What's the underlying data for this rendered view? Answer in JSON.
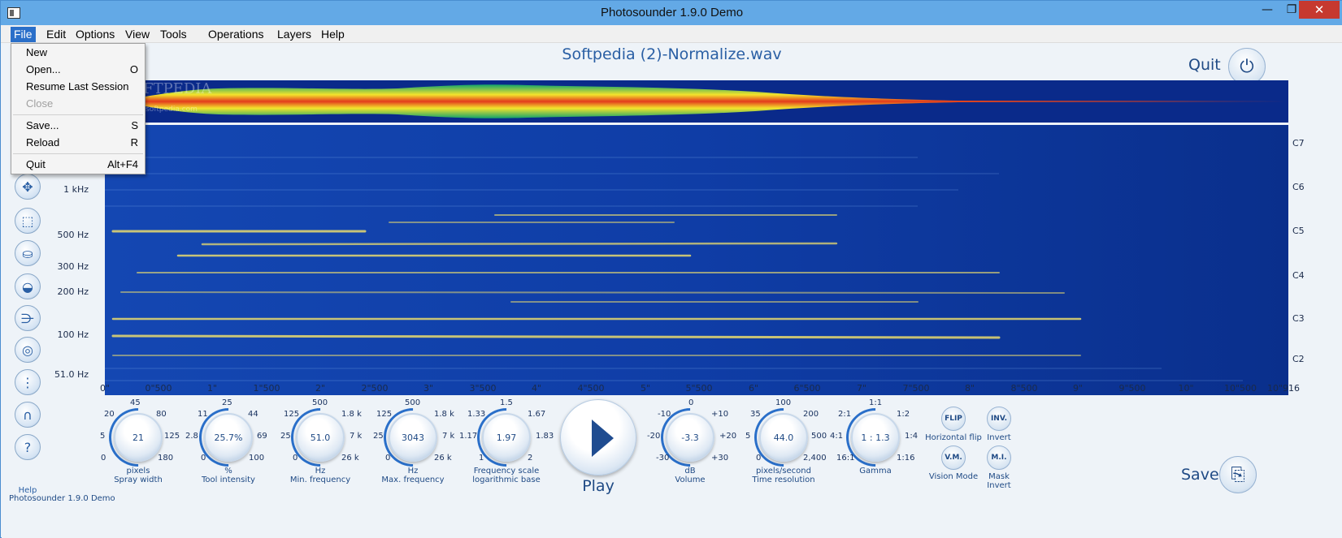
{
  "window": {
    "title": "Photosounder 1.9.0 Demo",
    "minimize": "—",
    "maximize": "❐",
    "close": "✕"
  },
  "menubar": {
    "items": [
      "File",
      "Edit",
      "Options",
      "View",
      "Tools",
      "Operations",
      "Layers",
      "Help"
    ],
    "active": "File"
  },
  "file_menu": {
    "items": [
      {
        "label": "New",
        "shortcut": ""
      },
      {
        "label": "Open...",
        "shortcut": "O"
      },
      {
        "label": "Resume Last Session",
        "shortcut": ""
      },
      {
        "label": "Close",
        "shortcut": "",
        "disabled": true
      },
      {
        "label": "Save...",
        "shortcut": "S"
      },
      {
        "label": "Reload",
        "shortcut": "R"
      },
      {
        "label": "Quit",
        "shortcut": "Alt+F4"
      }
    ]
  },
  "document": {
    "filename": "Softpedia (2)-Normalize.wav",
    "watermark": "SOFTPEDIA",
    "watermark_url": "www.softpedia.com"
  },
  "header": {
    "quit_label": "Quit"
  },
  "frequency_axis": [
    "1 kHz",
    "500 Hz",
    "300 Hz",
    "200 Hz",
    "100 Hz",
    "51.0 Hz"
  ],
  "note_axis": [
    "C7",
    "C6",
    "C5",
    "C4",
    "C3",
    "C2"
  ],
  "time_axis": [
    "0\"",
    "0\"500",
    "1\"",
    "1\"500",
    "2\"",
    "2\"500",
    "3\"",
    "3\"500",
    "4\"",
    "4\"500",
    "5\"",
    "5\"500",
    "6\"",
    "6\"500",
    "7\"",
    "7\"500",
    "8\"",
    "8\"500",
    "9\"",
    "9\"500",
    "10\"",
    "10\"500",
    "10\"916"
  ],
  "side_tools": {
    "icons": [
      "move-icon",
      "select-rect-icon",
      "bucket-icon",
      "pot-icon",
      "spray-icon",
      "gamepad-icon",
      "dots-icon",
      "magnet-icon",
      "help-icon"
    ],
    "help_label": "Help",
    "glyphs": [
      "✥",
      "⬚",
      "⛀",
      "◒",
      "⋺",
      "◎",
      "⋮",
      "∩",
      "?"
    ]
  },
  "knobs": [
    {
      "value": "21",
      "unit": "pixels",
      "name": "Spray width",
      "scale": [
        "0",
        "5",
        "20",
        "45",
        "80",
        "125",
        "180"
      ]
    },
    {
      "value": "25.7%",
      "unit": "%",
      "name": "Tool intensity",
      "scale": [
        "0",
        "2.8",
        "11",
        "25",
        "44",
        "69",
        "100"
      ]
    },
    {
      "value": "51.0",
      "unit": "Hz",
      "name": "Min. frequency",
      "scale": [
        "0",
        "25",
        "125",
        "500",
        "1.8 k",
        "7 k",
        "26 k"
      ]
    },
    {
      "value": "3043",
      "unit": "Hz",
      "name": "Max. frequency",
      "scale": [
        "0",
        "25",
        "125",
        "500",
        "1.8 k",
        "7 k",
        "26 k"
      ]
    },
    {
      "value": "1.97",
      "unit": "Frequency scale",
      "name": "logarithmic base",
      "scale": [
        "1",
        "1.17",
        "1.33",
        "1.5",
        "1.67",
        "1.83",
        "2"
      ]
    },
    {
      "value": "-3.3",
      "unit": "dB",
      "name": "Volume",
      "scale": [
        "-30",
        "-20",
        "-10",
        "0",
        "+10",
        "+20",
        "+30"
      ]
    },
    {
      "value": "44.0",
      "unit": "pixels/second",
      "name": "Time resolution",
      "scale": [
        "0",
        "5",
        "35",
        "100",
        "200",
        "500",
        "2,400"
      ]
    },
    {
      "value": "1 : 1.3",
      "unit": "Gamma",
      "name": "",
      "scale": [
        "16:1",
        "4:1",
        "2:1",
        "1:1",
        "1:2",
        "1:4",
        "1:16"
      ]
    }
  ],
  "play": {
    "label": "Play"
  },
  "toggles": [
    {
      "short": "FLIP",
      "caption": "Horizontal flip"
    },
    {
      "short": "INV.",
      "caption": "Invert"
    },
    {
      "short": "V.M.",
      "caption": "Vision Mode"
    },
    {
      "short": "M.I.",
      "caption": "Mask Invert"
    }
  ],
  "footer": {
    "save_label": "Save",
    "status": "Photosounder 1.9.0 Demo"
  },
  "colors": {
    "accent": "#2a5fa4",
    "spectro_bg": "#0a2f8c",
    "titlebar": "#63a9e6"
  }
}
